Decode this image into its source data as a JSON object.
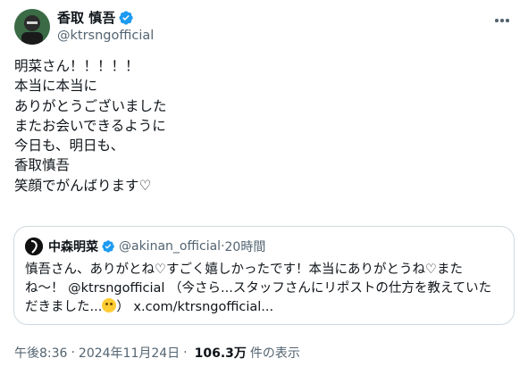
{
  "author": {
    "display_name": "香取 慎吾",
    "handle": "@ktrsngofficial",
    "verified": true,
    "badge_color": "#1d9bf0"
  },
  "post": {
    "lines": [
      "明菜さん！！！！！",
      "本当に本当に",
      "ありがとうございました",
      "またお会いできるように",
      "今日も、明日も、",
      "香取慎吾",
      "笑顔でがんばります♡"
    ]
  },
  "quote": {
    "display_name": "中森明菜",
    "handle": "@akinan_official",
    "dot": "·",
    "time": "20時間",
    "line1": "慎吾さん、ありがとね♡すごく嬉しかったです！本当にありがとうね♡また",
    "line2": "ね～！ @ktrsngofficial （今さら...スタッフさんにリポストの仕方を教えていた",
    "line3_prefix": "だきました...",
    "line3_suffix": "） x.com/ktrsngofficial...",
    "emoji": "grinning-sweat-emoji"
  },
  "meta": {
    "time": "午後8:36",
    "sep": "·",
    "date": "2024年11月24日",
    "sep2": "·",
    "views": "106.3万",
    "views_label": "件の表示"
  },
  "icons": {
    "more": "more-icon",
    "verified": "verified-badge-icon"
  }
}
